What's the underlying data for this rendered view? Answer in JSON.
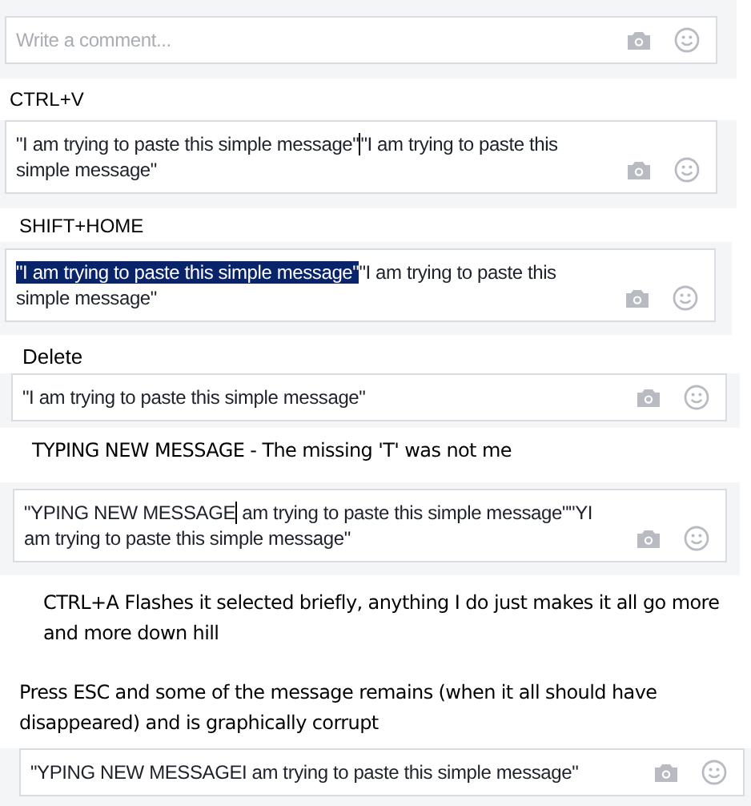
{
  "steps": [
    {
      "comment": {
        "placeholder": "Write a comment..."
      }
    },
    {
      "caption": "CTRL+V",
      "comment": {
        "segments": [
          {
            "text": "\"I am trying to paste this simple message\"",
            "selected": false,
            "caret": true
          },
          {
            "text": "\"I am trying to paste this simple message\"",
            "selected": false,
            "caret": false
          }
        ]
      }
    },
    {
      "caption": "SHIFT+HOME",
      "comment": {
        "segments": [
          {
            "text": "\"I am trying to paste this simple message\"",
            "selected": true,
            "caret": false
          },
          {
            "text": "\"I am trying to paste this simple message\"",
            "selected": false,
            "caret": false
          }
        ]
      }
    },
    {
      "caption": "Delete",
      "comment": {
        "segments": [
          {
            "text": "\"I am trying to paste this simple message\"",
            "selected": false,
            "caret": false
          }
        ]
      }
    },
    {
      "caption": "TYPING NEW MESSAGE   -  The missing 'T' was not me",
      "comment": {
        "segments": [
          {
            "text": "\"YPING NEW MESSAGE",
            "selected": false,
            "caret": true
          },
          {
            "text": " am trying to paste this simple message\"\"YI am trying to paste this simple message\"",
            "selected": false,
            "caret": false
          }
        ]
      }
    },
    {
      "caption": "CTRL+A Flashes it selected briefly, anything I do just makes it all go more and more down hill"
    },
    {
      "caption": "Press ESC and some of the message remains (when it all should have disappeared) and is graphically corrupt",
      "comment": {
        "segments": [
          {
            "text": "\"YPING NEW MESSAGEI am trying to paste this simple message\"",
            "selected": false,
            "caret": false
          }
        ]
      }
    }
  ]
}
